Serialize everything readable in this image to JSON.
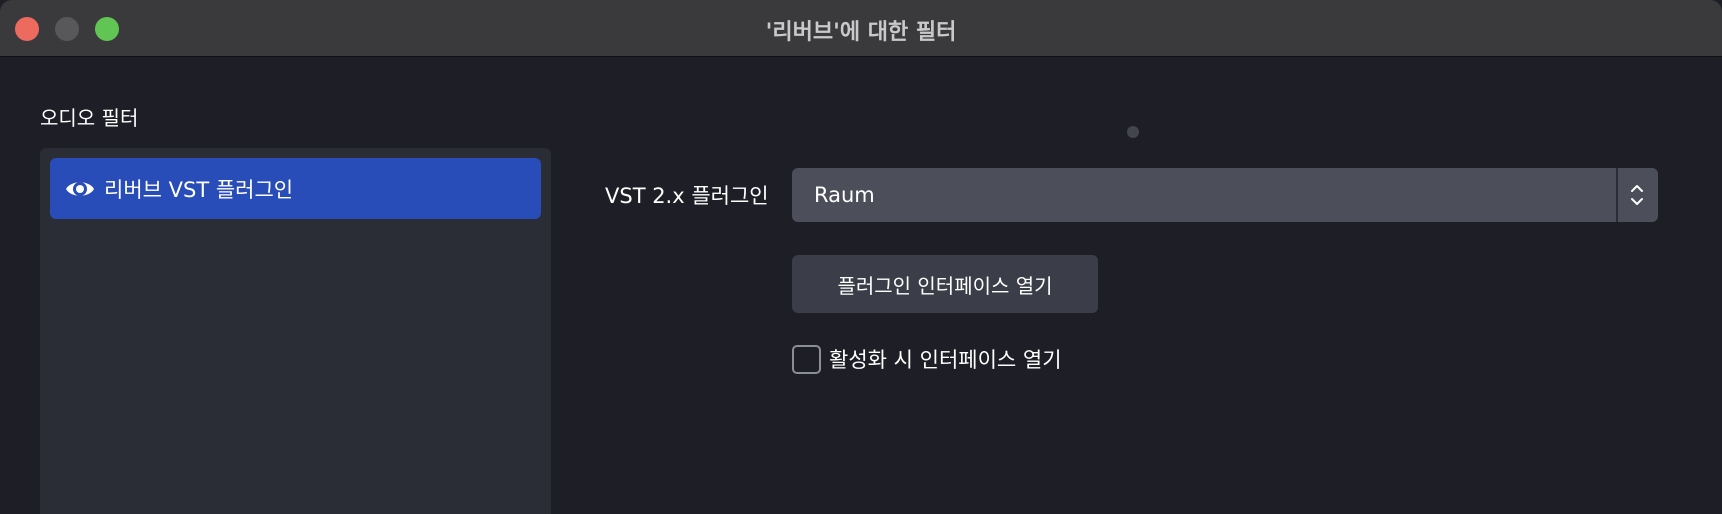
{
  "window": {
    "title": "'리버브'에 대한 필터"
  },
  "sidebar": {
    "section_label": "오디오 필터",
    "filters": [
      {
        "label": "리버브 VST 플러그인",
        "icon": "eye-icon",
        "selected": true,
        "visible": true
      }
    ]
  },
  "settings": {
    "plugin_label": "VST 2.x 플러그인",
    "plugin_value": "Raum",
    "open_interface_button": "플러그인 인터페이스 열기",
    "open_on_activate_label": "활성화 시 인터페이스 열기",
    "open_on_activate_checked": false
  },
  "colors": {
    "background": "#1e1f26",
    "titlebar": "#3a3a3c",
    "selected_item": "#284cb8",
    "list_background": "#2a2c36",
    "select_background": "#4c4f5a",
    "button_background": "#3b3e48",
    "traffic_close": "#ec6a5e",
    "traffic_minimize": "#58585b",
    "traffic_zoom": "#61c554"
  }
}
